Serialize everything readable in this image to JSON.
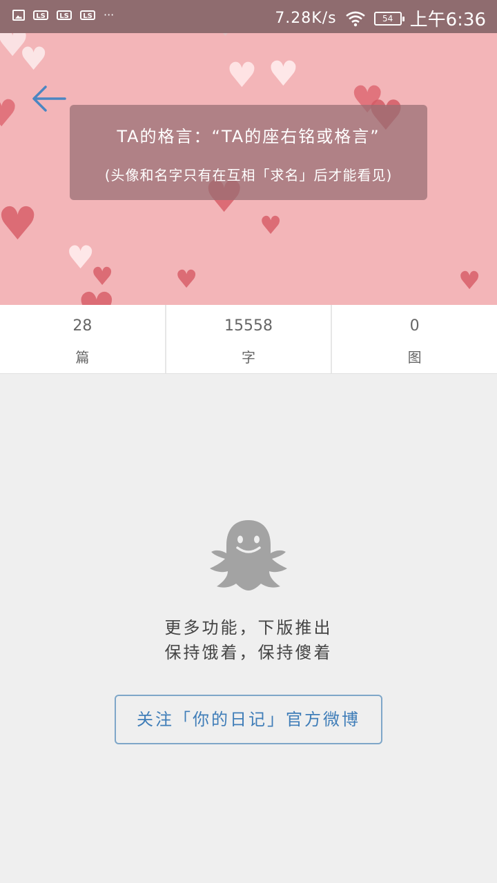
{
  "status_bar": {
    "notif_label": "LS",
    "more": "···",
    "net_speed": "7.28K/s",
    "battery": "54",
    "time": "上午6:36"
  },
  "header": {
    "motto": "TA的格言：“TA的座右铭或格言”",
    "note": "(头像和名字只有在互相「求名」后才能看见)"
  },
  "stats": [
    {
      "value": "28",
      "label": "篇"
    },
    {
      "value": "15558",
      "label": "字"
    },
    {
      "value": "0",
      "label": "图"
    }
  ],
  "empty_state": {
    "line1": "更多功能，下版推出",
    "line2": "保持饿着，保持傻着"
  },
  "weibo_button": "关注「你的日记」官方微博",
  "colors": {
    "header_bg": "#f3b5b8",
    "accent": "#3f7db8",
    "status_bar_bg": "#8f6c6f"
  }
}
